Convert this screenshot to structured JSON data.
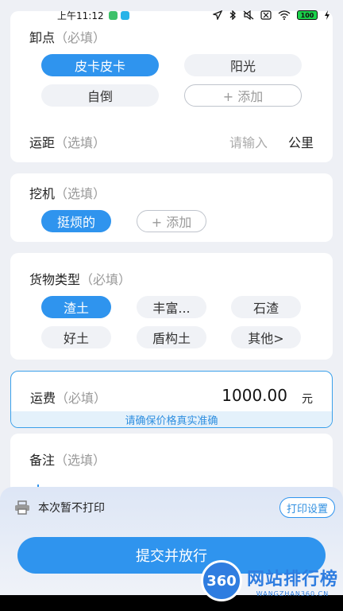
{
  "status_bar": {
    "time": "上午11:12",
    "battery": "100"
  },
  "unload": {
    "label": "卸点",
    "hint": "（必填）",
    "options": [
      {
        "label": "皮卡皮卡",
        "selected": true
      },
      {
        "label": "阳光",
        "selected": false
      },
      {
        "label": "自倒",
        "selected": false
      }
    ],
    "add_label": "+ 添加",
    "distance_label": "运距",
    "distance_hint": "（选填）",
    "distance_placeholder": "请输入",
    "distance_unit": "公里"
  },
  "digger": {
    "label": "挖机",
    "hint": "（选填）",
    "options": [
      {
        "label": "挺烦的",
        "selected": true
      }
    ],
    "add_label": "+ 添加"
  },
  "cargo": {
    "label": "货物类型",
    "hint": "（必填）",
    "options": [
      {
        "label": "渣土",
        "selected": true
      },
      {
        "label": "丰富...",
        "selected": false
      },
      {
        "label": "石渣",
        "selected": false
      },
      {
        "label": "好土",
        "selected": false
      },
      {
        "label": "盾构土",
        "selected": false
      },
      {
        "label": "其他>",
        "selected": false
      }
    ]
  },
  "fee": {
    "label": "运费",
    "hint": "（必填）",
    "value": "1000.00",
    "unit": "元",
    "notice": "请确保价格真实准确"
  },
  "remark": {
    "label": "备注",
    "hint": "（选填）"
  },
  "print": {
    "status": "本次暂不打印",
    "settings_label": "打印设置"
  },
  "submit_label": "提交并放行",
  "watermark": {
    "logo": "360",
    "title": "网站排行榜",
    "sub": "WANGZHAN360.CN"
  },
  "colors": {
    "accent": "#2f94ee",
    "chip_bg": "#f0f2f6",
    "page_bg": "#eef0f5"
  }
}
